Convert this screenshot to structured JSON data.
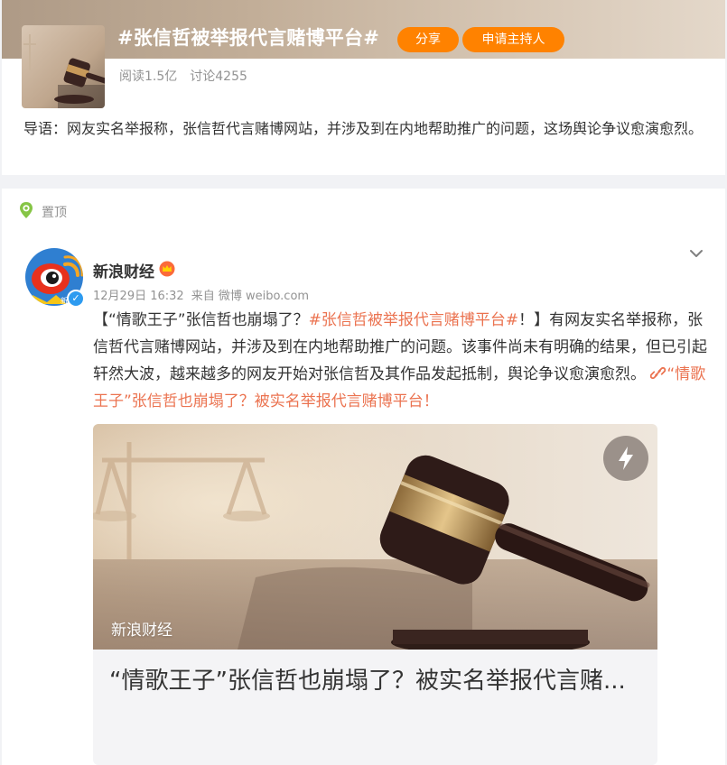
{
  "topic": {
    "title": "#张信哲被举报代言赌博平台#",
    "share_label": "分享",
    "apply_host_label": "申请主持人",
    "reads": "阅读1.5亿",
    "discussions": "讨论4255",
    "intro": "导语：网友实名举报称，张信哲代言赌博网站，并涉及到在内地帮助推广的问题，这场舆论争议愈演愈烈。",
    "accent_color": "#ff8200"
  },
  "post": {
    "pin_label": "置顶",
    "author": "新浪财经",
    "date": "12月29日 16:32",
    "source": "来自 微博 weibo.com",
    "verified_mark": "✓",
    "avatar_caption": "新浪",
    "text_prefix": "【“情歌王子”张信哲也崩塌了？",
    "hashtag": "#张信哲被举报代言赌博平台#",
    "text_after_hashtag": "！】有网友实名举报称，张信哲代言赌博网站，并涉及到在内地帮助推广的问题。该事件尚未有明确的结果，但已引起轩然大波，越来越多的网友开始对张信哲及其作品发起抵制，舆论争议愈演愈烈。 ",
    "article_link": "“情歌王子”张信哲也崩塌了？被实名举报代言赌博平台！",
    "link_color": "#eb7350",
    "icons": [
      "pin-icon",
      "chevron-down-icon",
      "crown-icon",
      "link-icon",
      "flash-icon"
    ]
  },
  "card": {
    "source_label": "新浪财经",
    "title": "“情歌王子”张信哲也崩塌了？被实名举报代言赌..."
  }
}
